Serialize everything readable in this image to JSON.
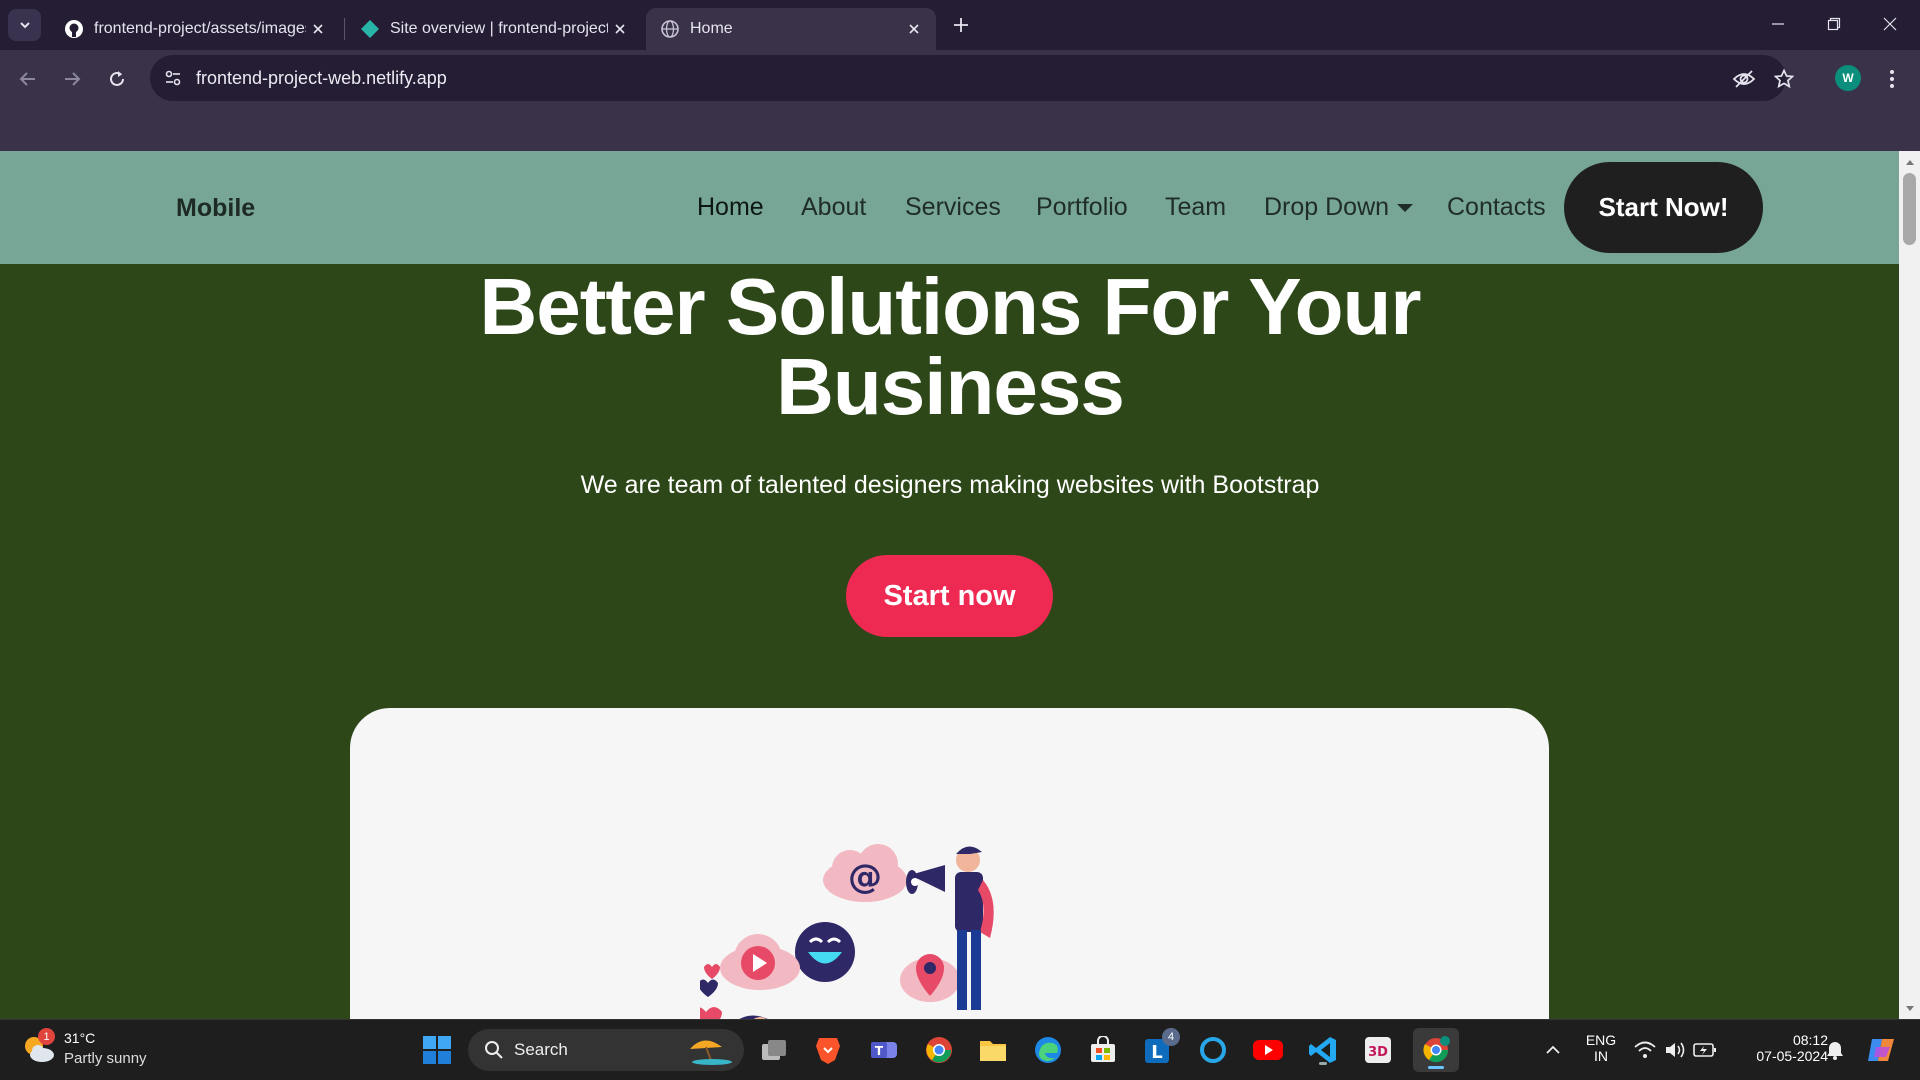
{
  "browser": {
    "tabs": [
      {
        "title": "frontend-project/assets/images",
        "favicon": "github-icon",
        "active": false
      },
      {
        "title": "Site overview | frontend-project",
        "favicon": "netlify-icon",
        "active": false
      },
      {
        "title": "Home",
        "favicon": "globe-icon",
        "active": true
      }
    ],
    "url": "frontend-project-web.netlify.app",
    "profile_initial": "W"
  },
  "site": {
    "logo": "Mobile",
    "nav": [
      "Home",
      "About",
      "Services",
      "Portfolio",
      "Team",
      "Drop Down",
      "Contacts"
    ],
    "cta_top": "Start Now!",
    "hero": {
      "title_line1": "Better Solutions For Your",
      "title_line2": "Business",
      "subtitle": "We are team of talented designers making websites with Bootstrap",
      "button": "Start now"
    }
  },
  "taskbar": {
    "weather": {
      "temp": "31°C",
      "condition": "Partly sunny",
      "badge": "1"
    },
    "search_label": "Search",
    "lang_line1": "ENG",
    "lang_line2": "IN",
    "time": "08:12",
    "date": "07-05-2024",
    "outlook_badge": "4"
  },
  "colors": {
    "page_bg": "#2d4719",
    "nav_bg": "#77a696",
    "cta_top_bg": "#1f1f1f",
    "hero_button": "#ef2a52"
  }
}
